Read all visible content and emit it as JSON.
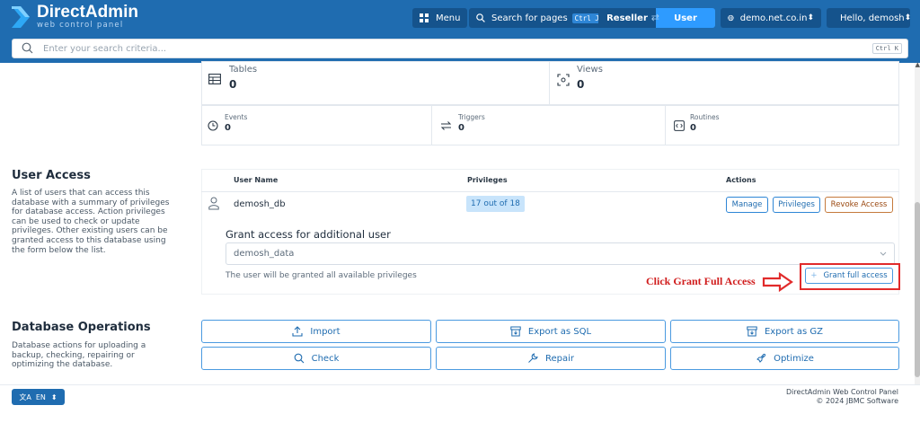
{
  "app": {
    "logo_title": "DirectAdmin",
    "logo_sub": "web control panel"
  },
  "topbar": {
    "menu_label": "Menu",
    "search_pages_label": "Search for pages",
    "search_pages_shortcut": "Ctrl J",
    "reseller_label": "Reseller",
    "user_label": "User",
    "domain_label": "demo.net.co.in",
    "greeting_label": "Hello, demosh"
  },
  "search": {
    "placeholder": "Enter your search criteria...",
    "shortcut": "Ctrl K"
  },
  "stats": {
    "tables_label": "Tables",
    "tables_value": "0",
    "views_label": "Views",
    "views_value": "0",
    "events_label": "Events",
    "events_value": "0",
    "triggers_label": "Triggers",
    "triggers_value": "0",
    "routines_label": "Routines",
    "routines_value": "0"
  },
  "user_access": {
    "title": "User Access",
    "description_lines": [
      "A list of users that can access this",
      "database with a summary of privileges",
      "for database access. Action privileges",
      "can be used to check or update",
      "privileges. Other existing users can be",
      "granted access to this database using",
      "the form below the list."
    ],
    "columns": {
      "user": "User Name",
      "privileges": "Privileges",
      "actions": "Actions"
    },
    "rows": [
      {
        "user": "demosh_db",
        "privileges": "17 out of 18",
        "actions": {
          "manage": "Manage",
          "privileges": "Privileges",
          "revoke": "Revoke Access"
        }
      }
    ],
    "grant_title": "Grant access for additional user",
    "grant_selected": "demosh_data",
    "grant_note": "The user will be granted all available privileges",
    "grant_button": "Grant full access",
    "annotation": "Click Grant Full Access"
  },
  "db_ops": {
    "title": "Database Operations",
    "description_lines": [
      "Database actions for uploading a",
      "backup, checking, repairing or",
      "optimizing the database."
    ],
    "import": "Import",
    "export_sql": "Export as SQL",
    "export_gz": "Export as GZ",
    "check": "Check",
    "repair": "Repair",
    "optimize": "Optimize"
  },
  "footer": {
    "lang": "EN",
    "line1": "DirectAdmin Web Control Panel",
    "line2": "© 2024 JBMC Software"
  },
  "colors": {
    "primary": "#1f6cb0",
    "accent": "#2e9bff",
    "annotation_red": "#e12b2b"
  }
}
